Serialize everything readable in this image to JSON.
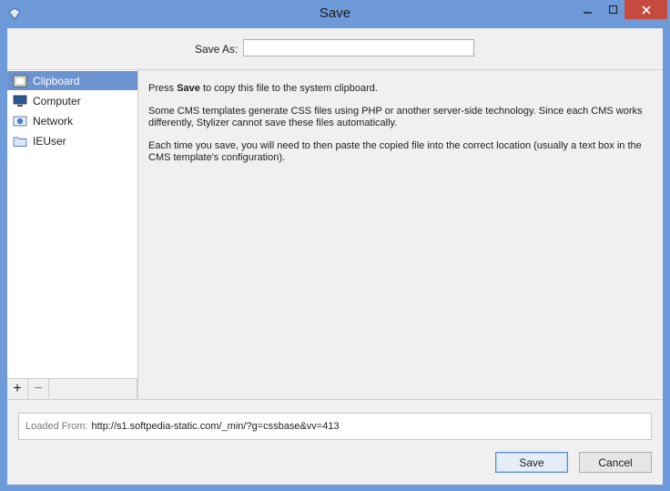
{
  "window": {
    "title": "Save"
  },
  "saveas": {
    "label": "Save As:",
    "value": ""
  },
  "sidebar": {
    "items": [
      {
        "label": "Clipboard",
        "icon": "clipboard-icon",
        "selected": true
      },
      {
        "label": "Computer",
        "icon": "computer-icon",
        "selected": false
      },
      {
        "label": "Network",
        "icon": "network-icon",
        "selected": false
      },
      {
        "label": "IEUser",
        "icon": "folder-icon",
        "selected": false
      }
    ],
    "add_label": "+",
    "remove_label": "−"
  },
  "content": {
    "p1_prefix": "Press ",
    "p1_bold": "Save",
    "p1_suffix": " to copy this file to the system clipboard.",
    "p2": "Some CMS templates generate CSS files using PHP or another server-side technology.  Since each CMS works differently, Stylizer cannot save these files automatically.",
    "p3": "Each time you save, you will need to then paste the copied file into the correct location (usually a text box in the CMS template's configuration)."
  },
  "bottom": {
    "loaded_label": "Loaded From:",
    "loaded_value": "http://s1.softpedia-static.com/_min/?g=cssbase&vv=413",
    "save_label": "Save",
    "cancel_label": "Cancel"
  },
  "colors": {
    "titlebar": "#6f9ad9",
    "selection": "#6c93cf",
    "close": "#c74a3e"
  }
}
